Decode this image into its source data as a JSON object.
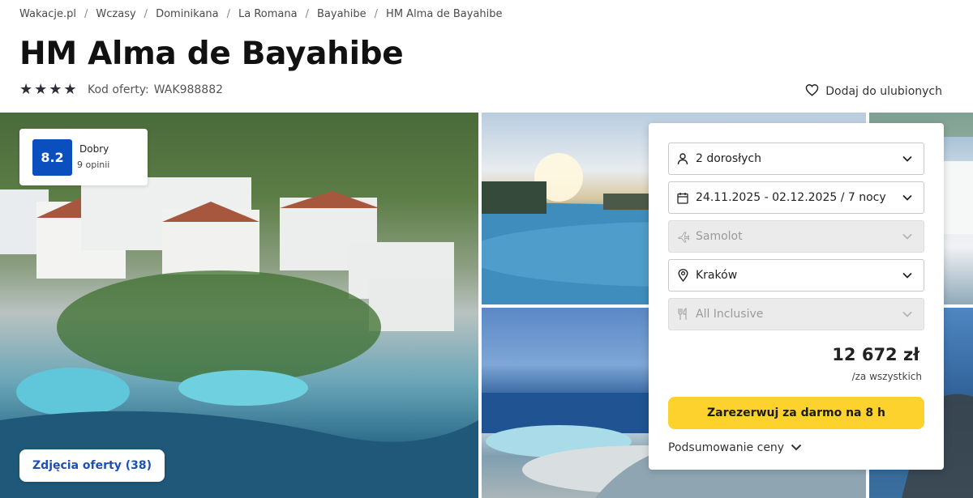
{
  "breadcrumb": [
    "Wakacje.pl",
    "Wczasy",
    "Dominikana",
    "La Romana",
    "Bayahibe",
    "HM Alma de Bayahibe"
  ],
  "hotel": {
    "title": "HM Alma de Bayahibe",
    "stars": 4,
    "offer_code_label": "Kod oferty:",
    "offer_code": "WAK988882",
    "favorite_label": "Dodaj do ulubionych"
  },
  "rating": {
    "score": "8.2",
    "word": "Dobry",
    "count": "9 opinii",
    "color": "#0b4fbe"
  },
  "photos_button_label": "Zdjęcia oferty (38)",
  "booking": {
    "guests": "2 dorosłych",
    "dates": "24.11.2025 - 02.12.2025 / 7 nocy",
    "transport": "Samolot",
    "departure": "Kraków",
    "board": "All Inclusive",
    "price": "12 672 zł",
    "price_note": "/za wszystkich",
    "book_button": "Zarezerwuj za darmo na 8 h",
    "book_button_color": "#fdd22c",
    "summary_label": "Podsumowanie ceny"
  }
}
